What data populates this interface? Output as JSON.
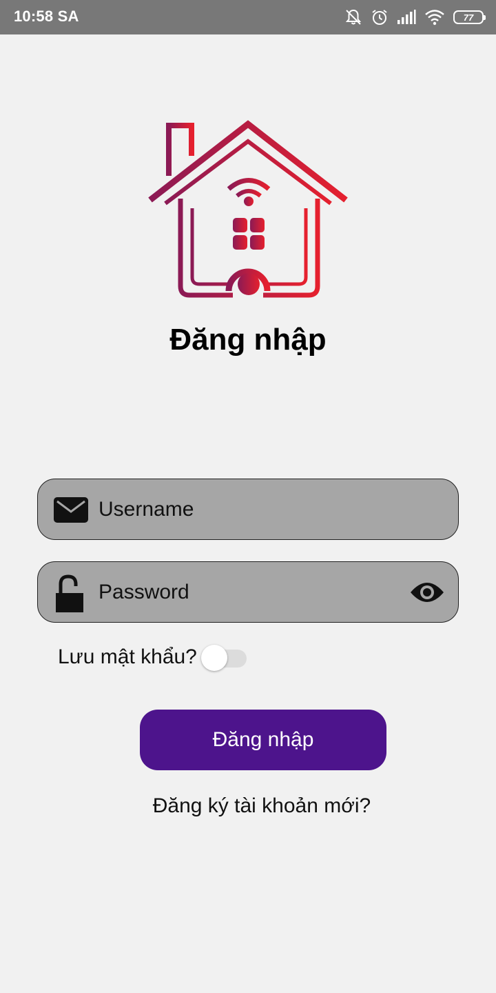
{
  "status_bar": {
    "time": "10:58 SA",
    "battery": "77",
    "icons": [
      "bell-off-icon",
      "alarm-icon",
      "signal-icon",
      "wifi-icon",
      "battery-icon"
    ]
  },
  "logo": {
    "icon": "smart-home-icon",
    "colors": [
      "#8b1a55",
      "#e5202e"
    ]
  },
  "page_title": "Đăng nhập",
  "form": {
    "username": {
      "icon": "mail-icon",
      "placeholder": "Username",
      "value": ""
    },
    "password": {
      "icon": "unlock-icon",
      "placeholder": "Password",
      "value": "",
      "toggle_icon": "eye-icon"
    },
    "remember": {
      "label": "Lưu mật khẩu?",
      "checked": false
    },
    "submit_label": "Đăng nhập",
    "register_link": "Đăng ký tài khoản mới?"
  },
  "colors": {
    "background": "#f1f1f1",
    "status_bar": "#787878",
    "field_bg": "#a6a6a6",
    "button": "#4d148c",
    "button_text": "#ffffff"
  }
}
